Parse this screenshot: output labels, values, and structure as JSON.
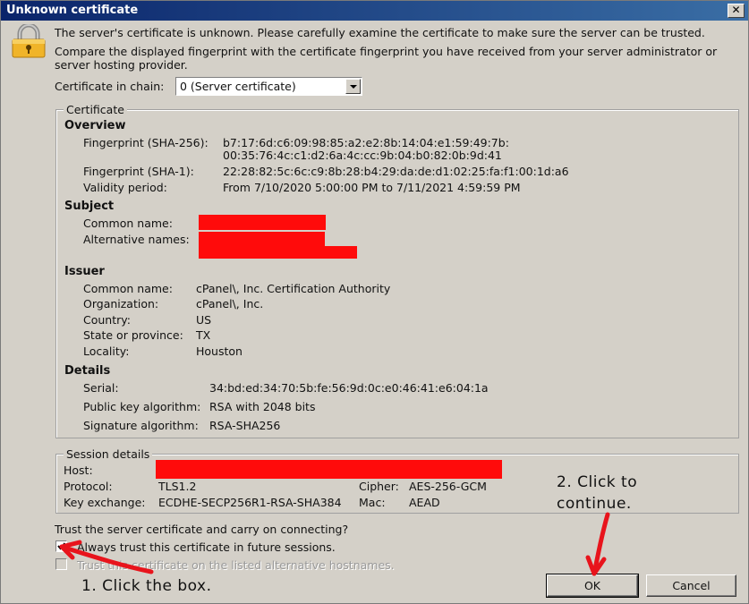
{
  "window": {
    "title": "Unknown certificate",
    "close_label": "✕"
  },
  "intro": {
    "line1": "The server's certificate is unknown. Please carefully examine the certificate to make sure the server can be trusted.",
    "line2a": "Compare the displayed fingerprint with the certificate fingerprint you have received from your server administrator or",
    "line2b": "server hosting provider."
  },
  "chain": {
    "label": "Certificate in chain:",
    "selected": "0 (Server certificate)"
  },
  "certificate": {
    "legend": "Certificate",
    "overview": {
      "heading": "Overview",
      "sha256_label": "Fingerprint (SHA-256):",
      "sha256_line1": "b7:17:6d:c6:09:98:85:a2:e2:8b:14:04:e1:59:49:7b:",
      "sha256_line2": "00:35:76:4c:c1:d2:6a:4c:cc:9b:04:b0:82:0b:9d:41",
      "sha1_label": "Fingerprint (SHA-1):",
      "sha1_value": "22:28:82:5c:6c:c9:8b:28:b4:29:da:de:d1:02:25:fa:f1:00:1d:a6",
      "validity_label": "Validity period:",
      "validity_value": "From 7/10/2020 5:00:00 PM to 7/11/2021 4:59:59 PM"
    },
    "subject": {
      "heading": "Subject",
      "common_name_label": "Common name:",
      "alt_names_label": "Alternative names:"
    },
    "issuer": {
      "heading": "Issuer",
      "common_name_label": "Common name:",
      "common_name_value": "cPanel\\, Inc. Certification Authority",
      "organization_label": "Organization:",
      "organization_value": "cPanel\\, Inc.",
      "country_label": "Country:",
      "country_value": "US",
      "state_label": "State or province:",
      "state_value": "TX",
      "locality_label": "Locality:",
      "locality_value": "Houston"
    },
    "details": {
      "heading": "Details",
      "serial_label": "Serial:",
      "serial_value": "34:bd:ed:34:70:5b:fe:56:9d:0c:e0:46:41:e6:04:1a",
      "pubkey_label": "Public key algorithm:",
      "pubkey_value": "RSA with 2048 bits",
      "sig_label": "Signature algorithm:",
      "sig_value": "RSA-SHA256"
    }
  },
  "session": {
    "legend": "Session details",
    "host_label": "Host:",
    "protocol_label": "Protocol:",
    "protocol_value": "TLS1.2",
    "cipher_label": "Cipher:",
    "cipher_value": "AES-256-GCM",
    "kex_label": "Key exchange:",
    "kex_value": "ECDHE-SECP256R1-RSA-SHA384",
    "mac_label": "Mac:",
    "mac_value": "AEAD"
  },
  "trust": {
    "question": "Trust the server certificate and carry on connecting?",
    "always_trust_label": "Always trust this certificate in future sessions.",
    "always_trust_checked": true,
    "alt_hostnames_label": "Trust this certificate on the listed alternative hostnames.",
    "alt_hostnames_checked": false
  },
  "buttons": {
    "ok": "OK",
    "cancel": "Cancel"
  },
  "annotations": {
    "step1": "1. Click the box.",
    "step2_line1": "2. Click to",
    "step2_line2": "continue.",
    "arrow_color": "#e8141c"
  },
  "redaction_color": "#ff0b0b",
  "icons": {
    "header": "lock-icon"
  }
}
